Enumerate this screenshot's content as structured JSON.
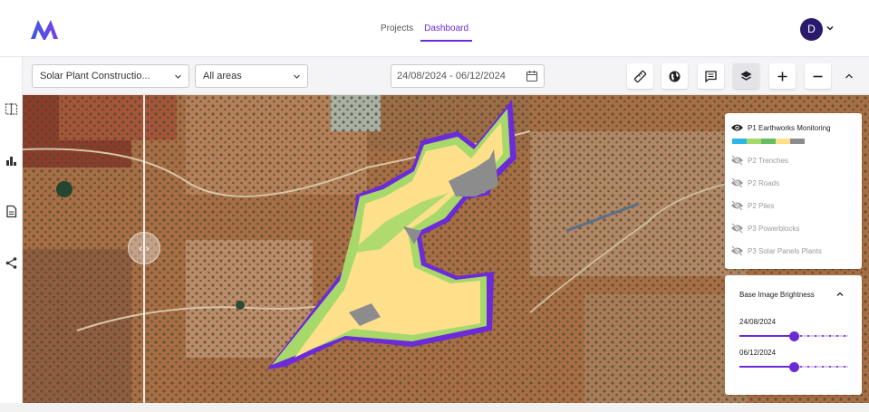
{
  "header": {
    "nav": [
      {
        "label": "Projects",
        "active": false
      },
      {
        "label": "Dashboard",
        "active": true
      }
    ],
    "avatar_initial": "D",
    "accent_color": "#6a2bd6"
  },
  "rail": {
    "icons": [
      "split-view-icon",
      "bar-chart-icon",
      "document-icon",
      "share-icon"
    ]
  },
  "toolbar": {
    "project_select": "Solar Plant Constructio...",
    "area_select": "All areas",
    "date_range": "24/08/2024 - 06/12/2024",
    "buttons": [
      "ruler-icon",
      "globe-icon",
      "comment-icon",
      "layers-icon",
      "zoom-in-icon",
      "zoom-out-icon"
    ]
  },
  "layers": {
    "items": [
      {
        "label": "P1 Earthworks Monitoring",
        "visible": true
      },
      {
        "label": "P2 Trenches",
        "visible": false
      },
      {
        "label": "P2 Roads",
        "visible": false
      },
      {
        "label": "P2 Piles",
        "visible": false
      },
      {
        "label": "P3 Powerblocks",
        "visible": false
      },
      {
        "label": "P3 Solar Panels Plants",
        "visible": false
      }
    ],
    "legend_colors": [
      "#2bb7e6",
      "#a6d96a",
      "#66bd63",
      "#fee08b",
      "#8c8c8c"
    ]
  },
  "brightness": {
    "title": "Base Image Brightness",
    "sliders": [
      {
        "label": "24/08/2024",
        "value": 0.5
      },
      {
        "label": "06/12/2024",
        "value": 0.5
      }
    ]
  }
}
